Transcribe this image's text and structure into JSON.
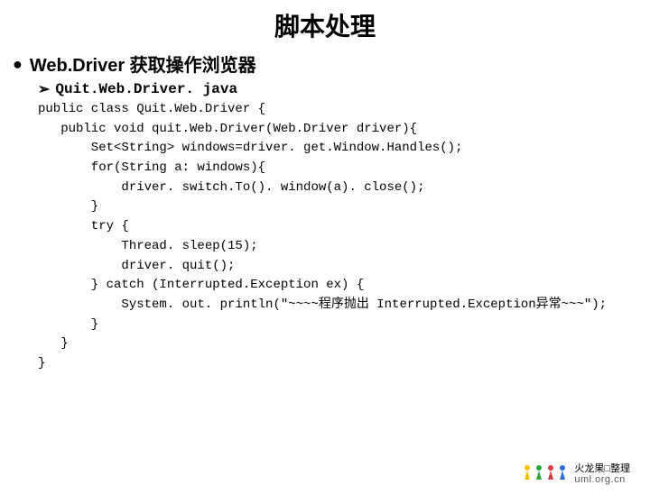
{
  "title": "脚本处理",
  "bullet": {
    "symbol": "●",
    "text": "Web.Driver 获取操作浏览器"
  },
  "sub": {
    "symbol": "➢",
    "text": "Quit.Web.Driver. java"
  },
  "code": "public class Quit.Web.Driver {\n   public void quit.Web.Driver(Web.Driver driver){\n       Set<String> windows=driver. get.Window.Handles();\n       for(String a: windows){\n           driver. switch.To(). window(a). close();\n       }\n       try {\n           Thread. sleep(15);\n           driver. quit();\n       } catch (Interrupted.Exception ex) {\n           System. out. println(\"~~~~程序抛出 Interrupted.Exception异常~~~\");\n       }\n   }\n}",
  "footer": {
    "line1": "火龙果□整理",
    "line2": "uml.org.cn"
  }
}
